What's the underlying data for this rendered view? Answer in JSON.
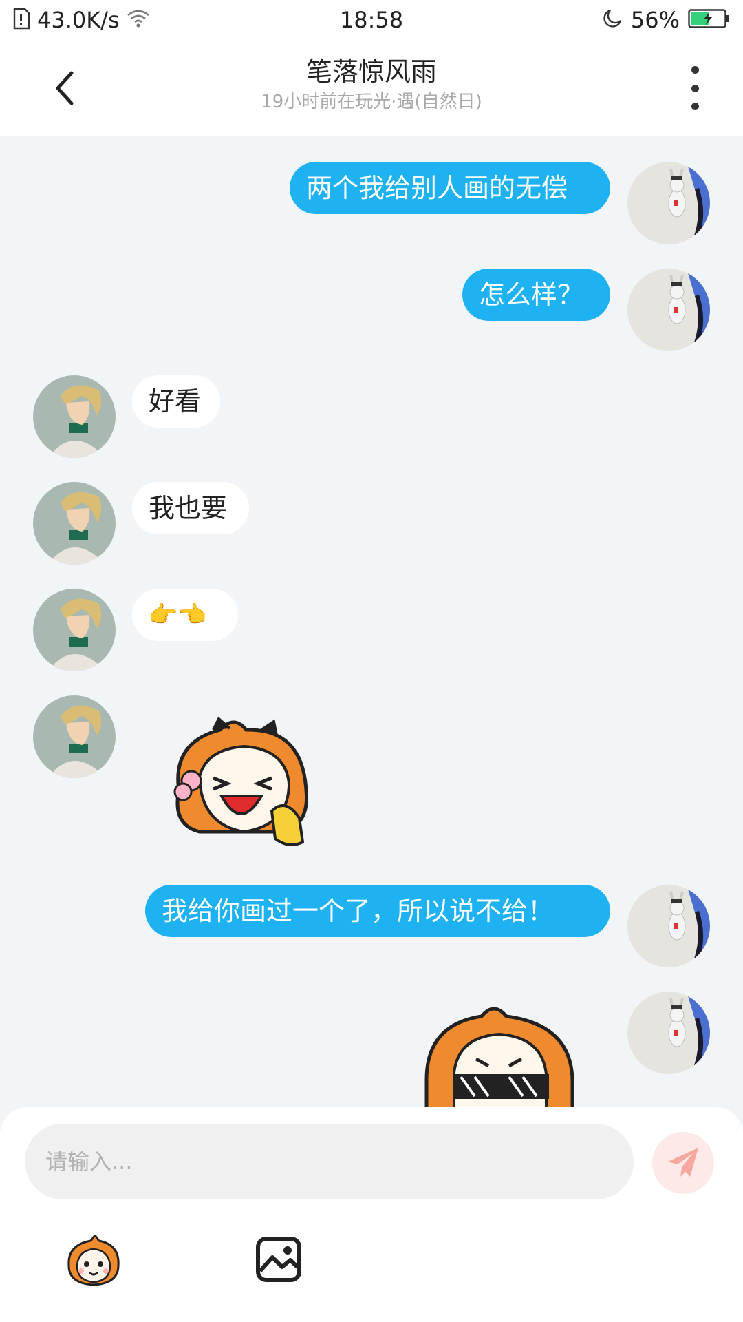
{
  "status_bar": {
    "net_speed": "43.0K/s",
    "time": "18:58",
    "battery": "56%",
    "battery_level": 0.56,
    "icons": [
      "sim-icon",
      "wifi-icon",
      "moon-icon",
      "battery-icon"
    ]
  },
  "header": {
    "title": "笔落惊风雨",
    "subtitle": "19小时前在玩光·遇(自然日)",
    "back_icon": "chevron-left-icon",
    "more_icon": "more-vertical-icon"
  },
  "messages": [
    {
      "direction": "out",
      "type": "text",
      "text": "两个我给别人画的无偿"
    },
    {
      "direction": "out",
      "type": "text",
      "text": "怎么样？"
    },
    {
      "direction": "in",
      "type": "text",
      "text": "好看"
    },
    {
      "direction": "in",
      "type": "text",
      "text": "我也要"
    },
    {
      "direction": "in",
      "type": "emoji",
      "text": "👉👈"
    },
    {
      "direction": "in",
      "type": "sticker",
      "sticker": "laughing-girl-sticker"
    },
    {
      "direction": "out",
      "type": "text",
      "text": "我给你画过一个了，所以说不给！"
    },
    {
      "direction": "out",
      "type": "sticker",
      "sticker": "sunglasses-girl-sticker"
    }
  ],
  "input": {
    "placeholder": "请输入...",
    "value": "",
    "send_icon": "send-icon"
  },
  "toolbar": {
    "sticker_icon": "sticker-icon",
    "image_icon": "image-icon"
  },
  "colors": {
    "outgoing_bubble": "#1fb2f3",
    "incoming_bubble": "#ffffff",
    "chat_background": "#f2f5f8",
    "send_button": "#fde9e7",
    "send_icon": "#f7a79d"
  }
}
